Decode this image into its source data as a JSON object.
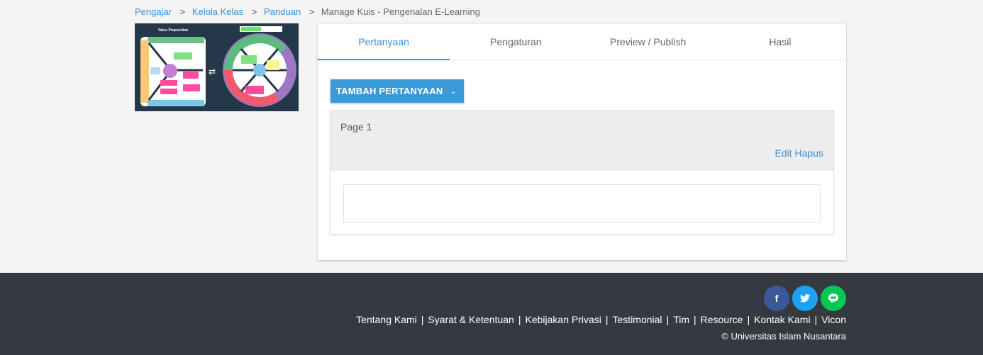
{
  "breadcrumb": {
    "items": [
      "Pengajar",
      "Kelola Kelas",
      "Panduan"
    ],
    "current": "Manage Kuis - Pengenalan E-Learning",
    "separator": ">"
  },
  "thumbnail": {
    "title": "Value Proposition",
    "alt": "Value proposition canvas diagram"
  },
  "tabs": [
    {
      "label": "Pertanyaan",
      "active": true
    },
    {
      "label": "Pengaturan",
      "active": false
    },
    {
      "label": "Preview / Publish",
      "active": false
    },
    {
      "label": "Hasil",
      "active": false
    }
  ],
  "add_button": {
    "label": "TAMBAH PERTANYAAN",
    "icon": "chevron-down-icon"
  },
  "page_card": {
    "title": "Page 1",
    "edit_label": "Edit",
    "delete_label": "Hapus"
  },
  "footer": {
    "social": [
      {
        "name": "facebook",
        "glyph": "f",
        "color": "#3b5998"
      },
      {
        "name": "twitter",
        "glyph": "t",
        "color": "#1da1f2"
      },
      {
        "name": "line",
        "glyph": "L",
        "color": "#06c755"
      }
    ],
    "links": [
      "Tentang Kami",
      "Syarat & Ketentuan",
      "Kebijakan Privasi",
      "Testimonial",
      "Tim",
      "Resource",
      "Kontak Kami",
      "Vicon"
    ],
    "link_separator": "|",
    "copyright": "© Universitas Islam Nusantara"
  },
  "colors": {
    "accent": "#3a8fd6",
    "button": "#3a9ad9",
    "footer_bg": "#343a40",
    "page_bg": "#f4f4f4"
  }
}
